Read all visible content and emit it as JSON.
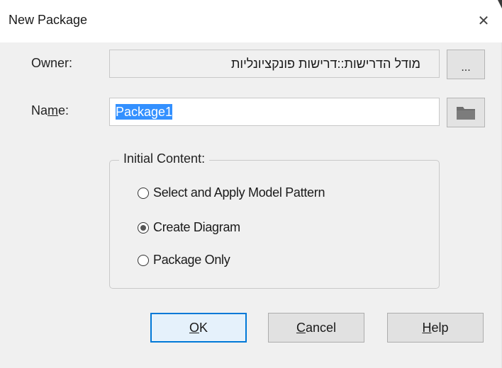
{
  "window": {
    "title": "New Package",
    "close_glyph": "✕"
  },
  "owner": {
    "label": "Owner:",
    "value": "מודל הדרישות::דרישות פונקציונליות",
    "browse_label": "..."
  },
  "name": {
    "label_prefix": "Na",
    "label_mnemonic": "m",
    "label_suffix": "e:",
    "value": "Package1",
    "browse_icon": "folder-icon"
  },
  "initial_content": {
    "label": "Initial Content:",
    "options": [
      {
        "label": "Select and Apply Model Pattern",
        "checked": false
      },
      {
        "label": "Create Diagram",
        "checked": true
      },
      {
        "label": "Package Only",
        "checked": false
      }
    ]
  },
  "buttons": {
    "ok_mnemonic": "O",
    "ok_rest": "K",
    "cancel_mnemonic": "C",
    "cancel_rest": "ancel",
    "help_mnemonic": "H",
    "help_rest": "elp"
  },
  "colors": {
    "dialog_bg": "#f0f0f0",
    "selection": "#3390ff",
    "default_button_border": "#0078d7"
  }
}
